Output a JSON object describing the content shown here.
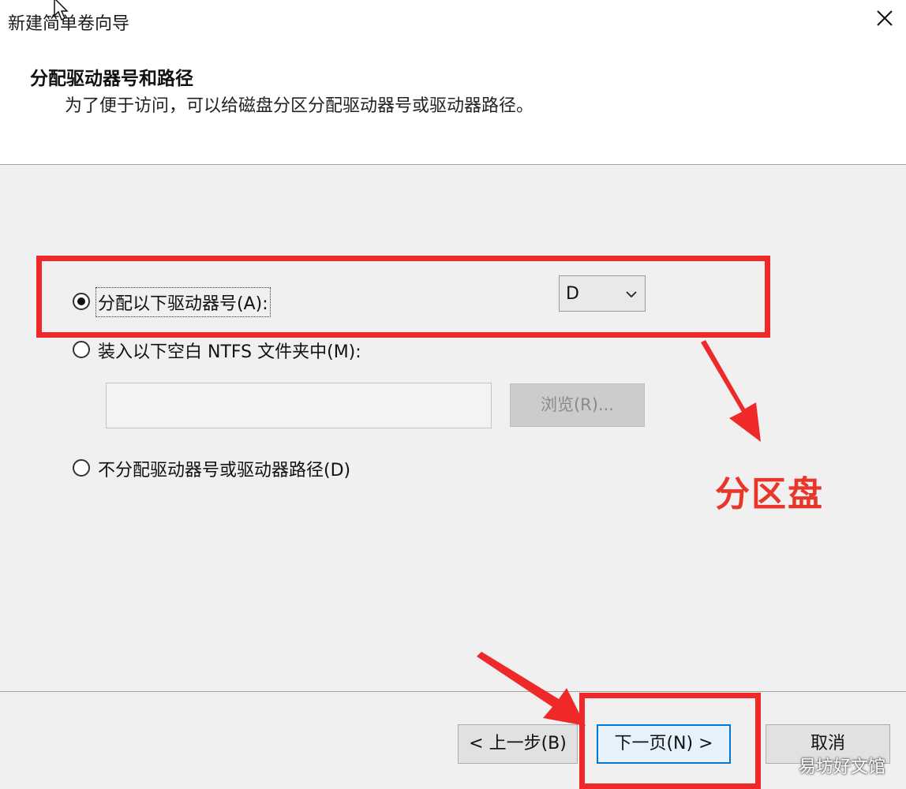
{
  "window": {
    "title": "新建简单卷向导"
  },
  "header": {
    "heading": "分配驱动器号和路径",
    "subtitle": "为了便于访问，可以给磁盘分区分配驱动器号或驱动器路径。"
  },
  "options": {
    "assign_letter": {
      "label": "分配以下驱动器号(A):",
      "checked": true
    },
    "mount_folder": {
      "label": "装入以下空白 NTFS 文件夹中(M):",
      "checked": false
    },
    "no_assign": {
      "label": "不分配驱动器号或驱动器路径(D)",
      "checked": false
    }
  },
  "drive_letter": {
    "selected": "D"
  },
  "folder_path": {
    "value": ""
  },
  "browse_label": "浏览(R)...",
  "buttons": {
    "back": "< 上一步(B)",
    "next": "下一页(N) >",
    "cancel": "取消"
  },
  "annotation": {
    "text": "分区盘",
    "color": "#ef2929"
  },
  "watermark": "易坊好文馆"
}
